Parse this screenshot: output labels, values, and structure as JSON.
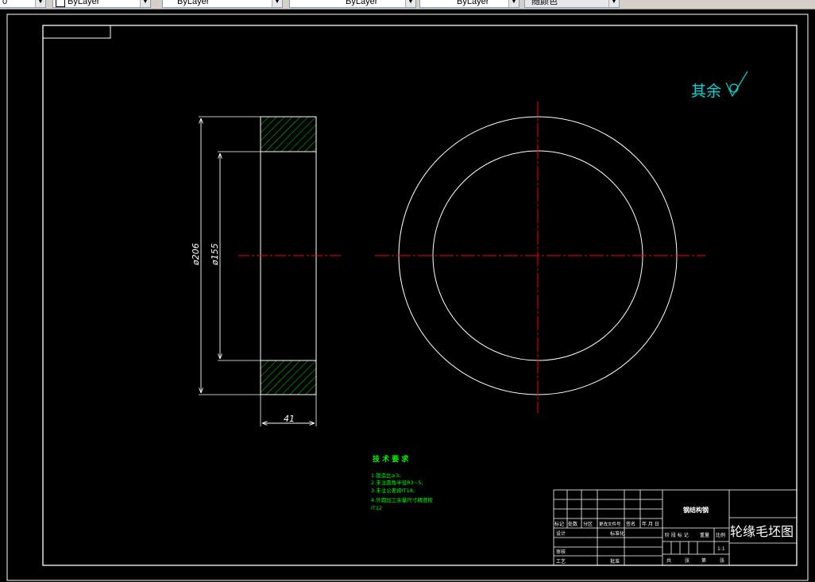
{
  "toolbar": {
    "layer_value": "0",
    "color_value": "ByLayer",
    "linetype_value": "ByLayer",
    "lineweight_value": "ByLayer",
    "plotstyle_value": "随颜色"
  },
  "colors": {
    "background": "#000000",
    "outline": "#ffffff",
    "hatch": "#00c000",
    "centerline": "#ff0000",
    "annotation": "#00d8d8",
    "notes": "#00ff00"
  },
  "drawing": {
    "surface_finish": {
      "text": "其余"
    },
    "dimensions": {
      "dia_outer": "ø206",
      "dia_inner": "ø155",
      "width": "41"
    },
    "tech_requirements": {
      "title": "技 术 要 求",
      "items": [
        "1.锻造比≥3;",
        "2.未注圆角半径R3~5;",
        "3.未注公差按IT18;",
        "4.外圆加工余量尺寸精度按",
        "IT12"
      ]
    },
    "title_block": {
      "material": "钢结构钢",
      "drawing_name": "轮缘毛坯图",
      "revision_labels": [
        "标记",
        "处数",
        "分区",
        "更改文件号",
        "签名",
        "年 月 日"
      ],
      "row_labels": [
        "设计",
        "审核",
        "工艺"
      ],
      "mid_labels": [
        "标准化",
        "批准"
      ],
      "stage_labels": [
        "阶 段 标 记",
        "重量",
        "比例"
      ],
      "scale": "1:1",
      "sheet_total": "共",
      "sheet_zhang": "张",
      "sheet_di": "第",
      "sheet_zhang2": "张"
    }
  }
}
